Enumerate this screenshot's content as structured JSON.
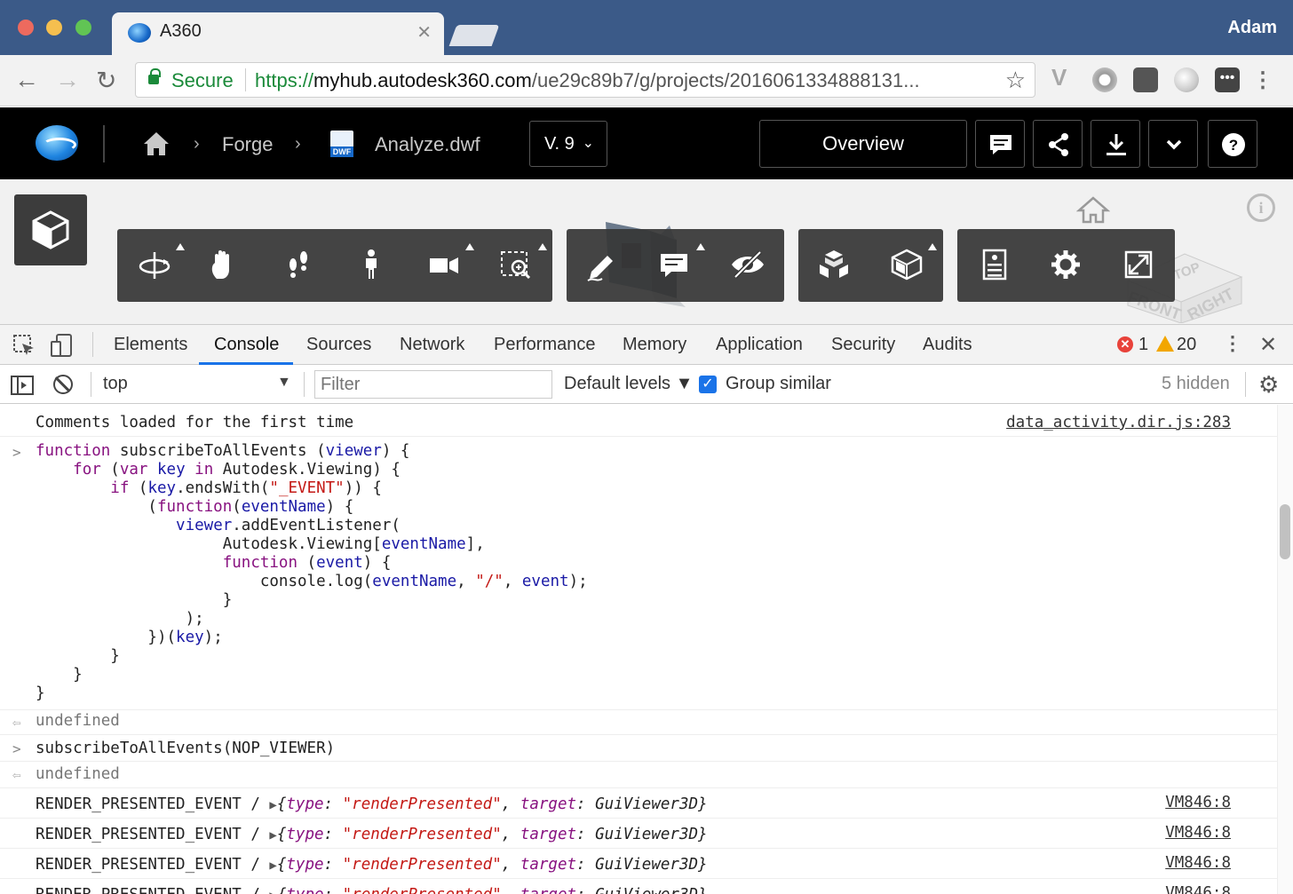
{
  "browser": {
    "tab_title": "A360",
    "tab_close": "✕",
    "profile_name": "Adam",
    "secure_label": "Secure",
    "url_scheme": "https://",
    "url_host": "myhub.autodesk360.com",
    "url_path": "/ue29c89b7/g/projects/2016061334888131..."
  },
  "app": {
    "breadcrumb": [
      "Forge",
      "Analyze.dwf"
    ],
    "file_badge": "DWF",
    "version_label": "V. 9",
    "overview_label": "Overview"
  },
  "viewcube": {
    "top": "TOP",
    "front": "FRONT",
    "right": "RIGHT"
  },
  "devtools": {
    "tabs": [
      "Elements",
      "Console",
      "Sources",
      "Network",
      "Performance",
      "Memory",
      "Application",
      "Security",
      "Audits"
    ],
    "active_tab": "Console",
    "error_count": "1",
    "warning_count": "20",
    "context": "top",
    "filter_placeholder": "Filter",
    "levels_label": "Default levels ▼",
    "group_similar_label": "Group similar",
    "hidden_label": "5 hidden"
  },
  "console": {
    "first_message": "Comments loaded for the first time",
    "first_source": "data_activity.dir.js:283",
    "code": [
      "function subscribeToAllEvents (viewer) {",
      "    for (var key in Autodesk.Viewing) {",
      "        if (key.endsWith(\"_EVENT\")) {",
      "            (function(eventName) {",
      "               viewer.addEventListener(",
      "                    Autodesk.Viewing[eventName],",
      "                    function (event) {",
      "                        console.log(eventName, \"/\", event);",
      "                    }",
      "                );",
      "            })(key);",
      "        }",
      "    }",
      "}"
    ],
    "result_1": "undefined",
    "command_2": "subscribeToAllEvents(NOP_VIEWER)",
    "result_2": "undefined",
    "log_prefix": "RENDER_PRESENTED_EVENT / ",
    "log_type_key": "type",
    "log_type_value": "\"renderPresented\"",
    "log_target_key": "target",
    "log_target_value": "GuiViewer3D",
    "log_source": "VM846:8"
  }
}
